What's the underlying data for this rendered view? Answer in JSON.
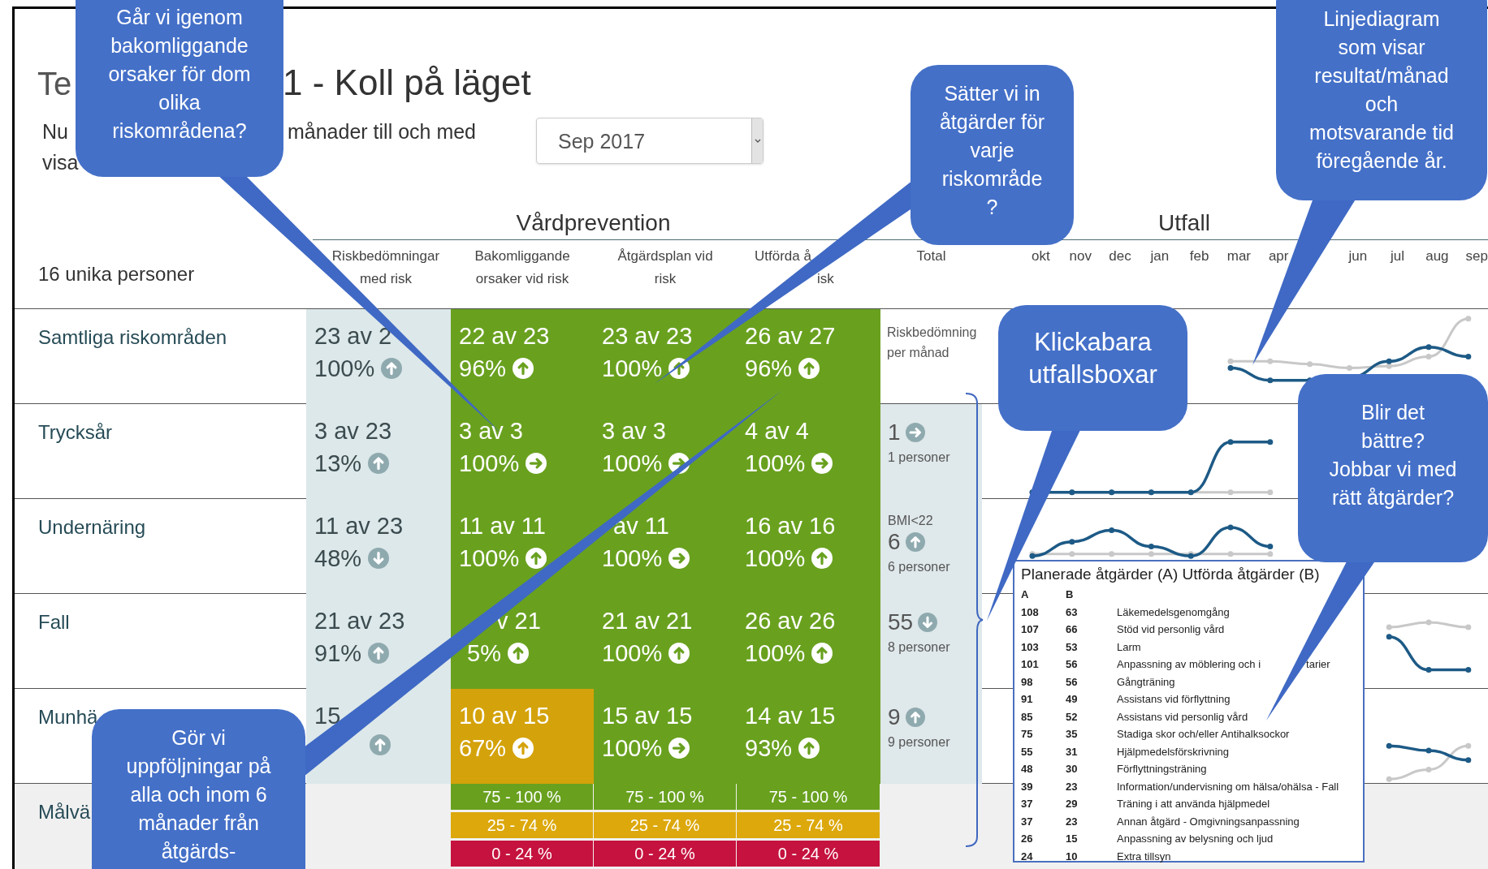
{
  "title": {
    "start": "Te",
    "end": "1  - Koll på läget"
  },
  "intro": {
    "line1_start": "Nu",
    "line1_end": "månader till och med",
    "line2": "visa"
  },
  "month_select": {
    "value": "Sep 2017"
  },
  "groups": [
    "Vårdprevention",
    "Utfall"
  ],
  "persons": "16 unika personer",
  "columns": [
    {
      "lines": [
        "Riskbedömningar",
        "med risk"
      ]
    },
    {
      "lines": [
        "Bakomliggande",
        "orsaker vid risk"
      ]
    },
    {
      "lines": [
        "Åtgärdsplan vid",
        "risk"
      ]
    },
    {
      "lines": [
        "Utförda å",
        "isk"
      ]
    },
    {
      "lines": [
        "Total"
      ]
    }
  ],
  "month_groups": [
    [
      "okt",
      "nov",
      "dec",
      "jan",
      "feb",
      "mar",
      "apr"
    ],
    [
      "jun",
      "jul",
      "aug",
      "sep"
    ]
  ],
  "rows": [
    {
      "label": "Samtliga riskområden",
      "cells": [
        {
          "count": "23 av 2",
          "percent": "100%",
          "arrow": {
            "kind": "up"
          }
        },
        {
          "count": "22 av 23",
          "percent": "96%",
          "arrow": {
            "kind": "up"
          },
          "color": "#69a11f"
        },
        {
          "count": "23 av 23",
          "percent": "100%",
          "arrow": {
            "kind": "up"
          },
          "color": "#69a11f"
        },
        {
          "count": "26 av 27",
          "percent": "96%",
          "arrow": {
            "kind": "up"
          },
          "color": "#69a11f"
        }
      ],
      "total": {
        "kind": "note",
        "text": "Riskbedömning per månad"
      }
    },
    {
      "label": "Trycksår",
      "cells": [
        {
          "count": "3 av 23",
          "percent": "13%",
          "arrow": {
            "kind": "up"
          }
        },
        {
          "count": "3 av 3",
          "percent": "100%",
          "arrow": {
            "kind": "right"
          },
          "color": "#69a11f"
        },
        {
          "count": "3 av 3",
          "percent": "100%",
          "arrow": {
            "kind": "right"
          },
          "color": "#69a11f"
        },
        {
          "count": "4 av 4",
          "percent": "100%",
          "arrow": {
            "kind": "right"
          },
          "color": "#69a11f"
        }
      ],
      "total": {
        "kind": "value",
        "value": "1",
        "arrow": {
          "kind": "right"
        },
        "persons": "1 personer"
      }
    },
    {
      "label": "Undernäring",
      "cells": [
        {
          "count": "11 av 23",
          "percent": "48%",
          "arrow": {
            "kind": "down"
          }
        },
        {
          "count": "11 av 11",
          "percent": "100%",
          "arrow": {
            "kind": "up"
          },
          "color": "#69a11f"
        },
        {
          "count": "av 11",
          "percent": "100%",
          "arrow": {
            "kind": "right"
          },
          "color": "#69a11f"
        },
        {
          "count": "16 av 16",
          "percent": "100%",
          "arrow": {
            "kind": "up"
          },
          "color": "#69a11f"
        }
      ],
      "total": {
        "kind": "value",
        "caption": "BMI<22",
        "value": "6",
        "arrow": {
          "kind": "up"
        },
        "persons": "6 personer"
      }
    },
    {
      "label": "Fall",
      "cells": [
        {
          "count": "21 av 23",
          "percent": "91%",
          "arrow": {
            "kind": "up"
          }
        },
        {
          "count": "v 21",
          "percent": "5%",
          "arrow": {
            "kind": "up"
          },
          "color": "#69a11f"
        },
        {
          "count": "21 av 21",
          "percent": "100%",
          "arrow": {
            "kind": "up"
          },
          "color": "#69a11f"
        },
        {
          "count": "26 av 26",
          "percent": "100%",
          "arrow": {
            "kind": "up"
          },
          "color": "#69a11f"
        }
      ],
      "total": {
        "kind": "value",
        "value": "55",
        "arrow": {
          "kind": "down"
        },
        "persons": "8 personer"
      }
    },
    {
      "label": "Munhä",
      "cells": [
        {
          "count": "15",
          "arrow": {
            "kind": "up"
          }
        },
        {
          "count": "10 av 15",
          "percent": "67%",
          "arrow": {
            "kind": "up"
          },
          "color": "#d4a20a"
        },
        {
          "count": "15 av 15",
          "percent": "100%",
          "arrow": {
            "kind": "right"
          },
          "color": "#69a11f"
        },
        {
          "count": "14 av 15",
          "percent": "93%",
          "arrow": {
            "kind": "up"
          },
          "color": "#69a11f"
        }
      ],
      "total": {
        "kind": "value",
        "value": "9",
        "arrow": {
          "kind": "up"
        },
        "persons": "9 personer"
      }
    }
  ],
  "target_label": "Målvä",
  "target_columns": [
    {
      "bands": [
        {
          "label": "75 - 100 %",
          "color": "#69a11f"
        },
        {
          "label": "25 - 74 %",
          "color": "#dca80c"
        },
        {
          "label": "0 - 24 %",
          "color": "#c5123e"
        }
      ]
    },
    {
      "bands": [
        {
          "label": "75 - 100 %",
          "color": "#69a11f"
        },
        {
          "label": "25 - 74 %",
          "color": "#dca80c"
        },
        {
          "label": "0 - 24 %",
          "color": "#c5123e"
        }
      ]
    },
    {
      "bands": [
        {
          "label": "75 - 100 %",
          "color": "#69a11f"
        },
        {
          "label": "25 - 74 %",
          "color": "#dca80c"
        },
        {
          "label": "0 - 24 %",
          "color": "#c5123e"
        }
      ]
    }
  ],
  "popup": {
    "title": "Planerade åtgärder (A) Utförda åtgärder (B)",
    "headers": [
      "A",
      "B"
    ],
    "rows": [
      {
        "a": "108",
        "b": "63",
        "label": "Läkemedelsgenomgång"
      },
      {
        "a": "107",
        "b": "66",
        "label": "Stöd vid personlig vård"
      },
      {
        "a": "103",
        "b": "53",
        "label": "Larm"
      },
      {
        "a": "101",
        "b": "56",
        "label": "Anpassning av möblering och i",
        "label_end": "tarier"
      },
      {
        "a": "98",
        "b": "56",
        "label": "Gångträning"
      },
      {
        "a": "91",
        "b": "49",
        "label": "Assistans vid förflyttning"
      },
      {
        "a": "85",
        "b": "52",
        "label": "Assistans vid personlig vård"
      },
      {
        "a": "75",
        "b": "35",
        "label": "Stadiga skor och/eller Antihalksockor"
      },
      {
        "a": "55",
        "b": "31",
        "label": "Hjälpmedelsförskrivning"
      },
      {
        "a": "48",
        "b": "30",
        "label": "Förflyttningsträning"
      },
      {
        "a": "39",
        "b": "23",
        "label": "Information/undervisning om hälsa/ohälsa - Fall"
      },
      {
        "a": "37",
        "b": "29",
        "label": "Träning i att använda hjälpmedel"
      },
      {
        "a": "37",
        "b": "23",
        "label": "Annan åtgärd - Omgivningsanpassning"
      },
      {
        "a": "26",
        "b": "15",
        "label": "Anpassning av belysning och ljud"
      },
      {
        "a": "24",
        "b": "10",
        "label": "Extra tillsyn"
      }
    ]
  },
  "callouts": [
    {
      "text": "Går vi igenom\nbakomliggande\norsaker för dom\nolika\nriskområdena?"
    },
    {
      "text": "Sätter vi in\nåtgärder för\nvarje\nriskområde\n?"
    },
    {
      "text": "Linjediagram\nsom visar\nresultat/månad\noch\nmotsvarande tid\nföregående år."
    },
    {
      "text": "Klickabara\nutfallsboxar"
    },
    {
      "text": "Blir det\nbättre?\nJobbar vi med\nrätt åtgärder?"
    },
    {
      "text": "Gör vi\nuppföljningar på\nalla och inom 6\nmånader från\nåtgärds-"
    }
  ]
}
